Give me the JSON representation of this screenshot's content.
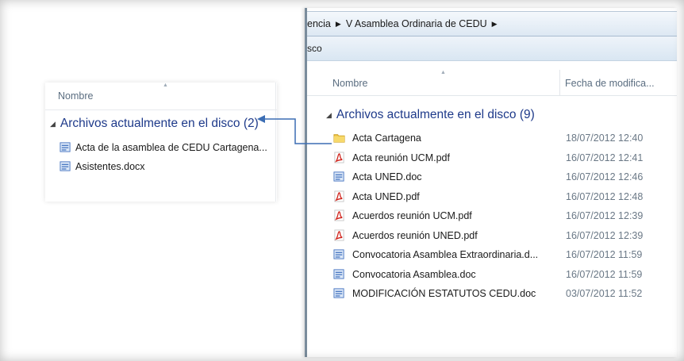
{
  "right_window": {
    "breadcrumb": [
      "encia",
      "V Asamblea Ordinaria de CEDU"
    ],
    "toolbar_text": "sco",
    "columns": {
      "name": "Nombre",
      "date": "Fecha de modifica..."
    },
    "group_label": "Archivos actualmente en el disco (9)",
    "files": [
      {
        "name": "Acta Cartagena",
        "date": "18/07/2012 12:40",
        "icon": "folder-icon"
      },
      {
        "name": "Acta reunión UCM.pdf",
        "date": "16/07/2012 12:41",
        "icon": "pdf-icon"
      },
      {
        "name": "Acta UNED.doc",
        "date": "16/07/2012 12:46",
        "icon": "word-doc-icon"
      },
      {
        "name": "Acta UNED.pdf",
        "date": "16/07/2012 12:48",
        "icon": "pdf-icon"
      },
      {
        "name": "Acuerdos reunión UCM.pdf",
        "date": "16/07/2012 12:39",
        "icon": "pdf-icon"
      },
      {
        "name": "Acuerdos reunión UNED.pdf",
        "date": "16/07/2012 12:39",
        "icon": "pdf-icon"
      },
      {
        "name": "Convocatoria Asamblea Extraordinaria.d...",
        "date": "16/07/2012 11:59",
        "icon": "word-doc-icon"
      },
      {
        "name": "Convocatoria Asamblea.doc",
        "date": "16/07/2012 11:59",
        "icon": "word-doc-icon"
      },
      {
        "name": "MODIFICACIÓN ESTATUTOS CEDU.doc",
        "date": "03/07/2012 11:52",
        "icon": "word-doc-icon"
      }
    ]
  },
  "left_window": {
    "column_name": "Nombre",
    "group_label": "Archivos actualmente en el disco (2)",
    "files": [
      {
        "name": "Acta de la asamblea de CEDU Cartagena...",
        "icon": "word-doc-icon"
      },
      {
        "name": "Asistentes.docx",
        "icon": "word-doc-icon"
      }
    ]
  },
  "colors": {
    "group_header": "#1e3a8a",
    "date_text": "#6a7886",
    "arrow": "#3b6db4"
  }
}
